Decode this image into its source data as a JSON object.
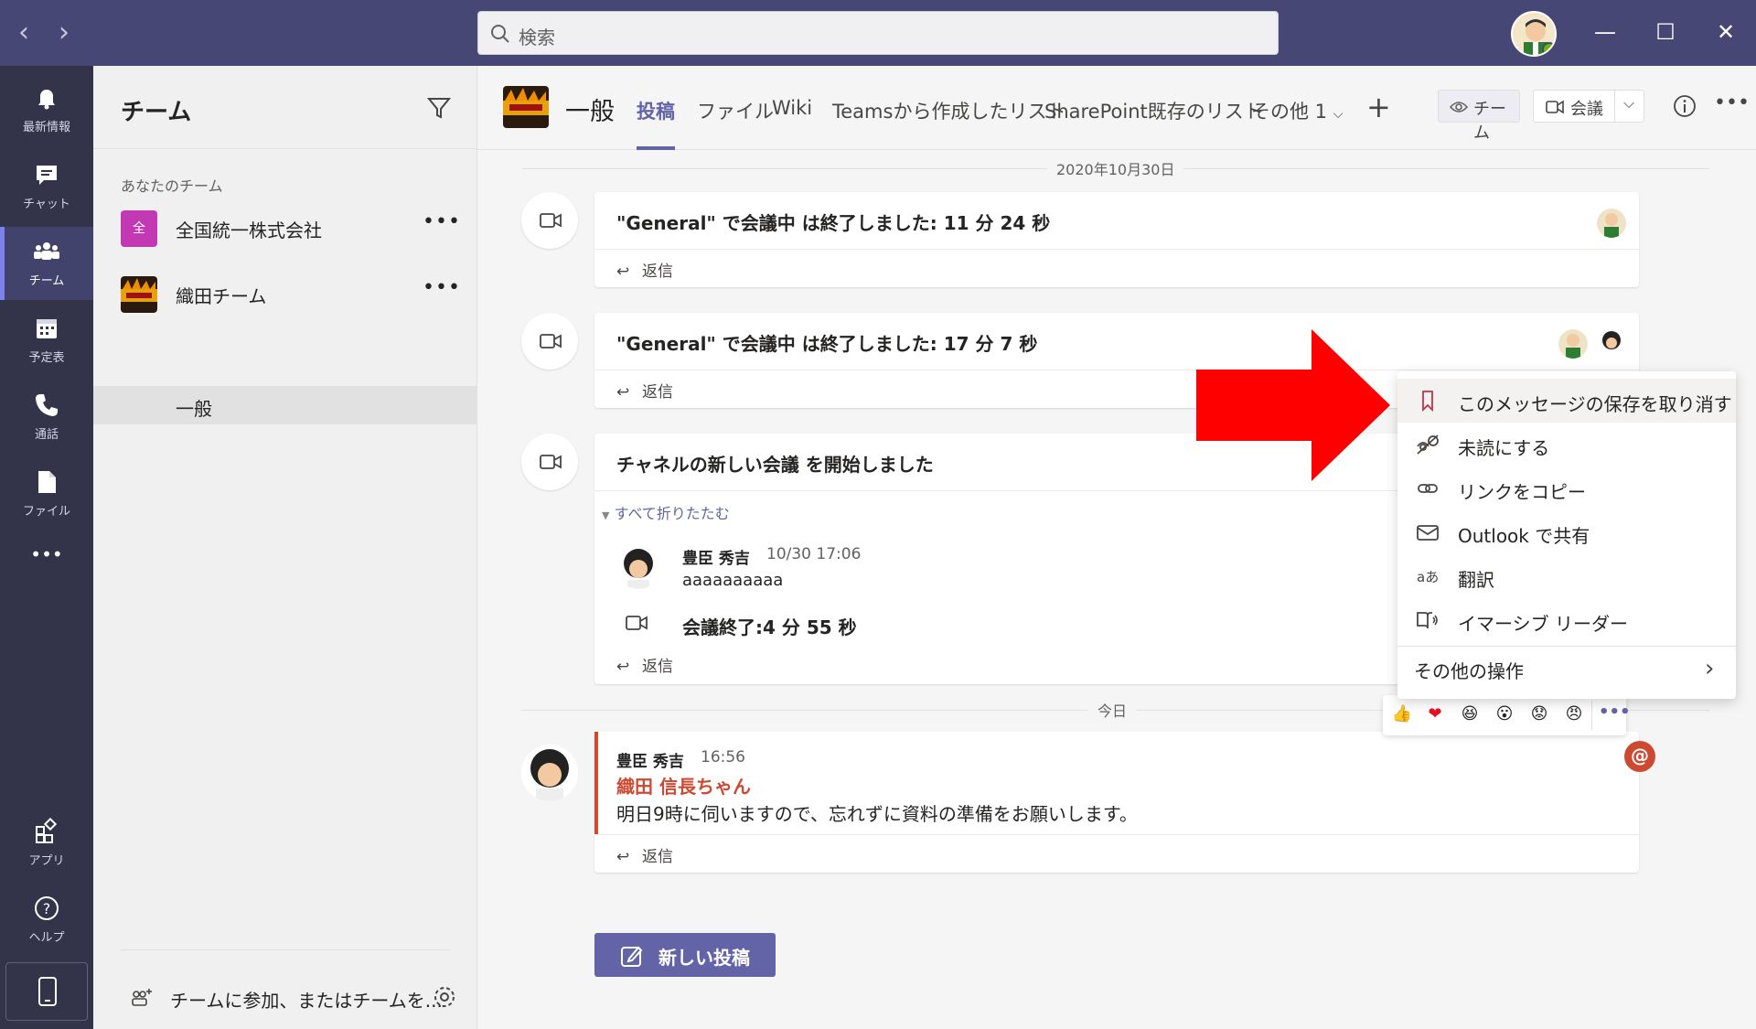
{
  "search": {
    "placeholder": "検索"
  },
  "appbar": {
    "items": [
      {
        "label": "最新情報",
        "icon": "bell-icon"
      },
      {
        "label": "チャット",
        "icon": "chat-icon"
      },
      {
        "label": "チーム",
        "icon": "teams-icon",
        "active": true
      },
      {
        "label": "予定表",
        "icon": "calendar-icon"
      },
      {
        "label": "通話",
        "icon": "phone-icon"
      },
      {
        "label": "ファイル",
        "icon": "file-icon"
      },
      {
        "label": "アプリ",
        "icon": "apps-icon"
      },
      {
        "label": "ヘルプ",
        "icon": "help-icon"
      }
    ],
    "more": "•••"
  },
  "teams_pane": {
    "title": "チーム",
    "section_label": "あなたのチーム",
    "teams": [
      {
        "name": "全国統一株式会社",
        "logo_text": "全",
        "logo_color": "#c239b3"
      },
      {
        "name": "織田チーム"
      }
    ],
    "more": "•••",
    "channel": "一般",
    "join_text": "チームに参加、またはチームを..."
  },
  "channel_header": {
    "title": "一般",
    "tabs": [
      "投稿",
      "ファイル",
      "Wiki",
      "Teamsから作成したリスト",
      "SharePoint既存のリスト",
      "その他 1"
    ],
    "add": "+",
    "team_button": "チーム",
    "meet_button": "会議"
  },
  "messages": {
    "date1": "2020年10月30日",
    "reply_label": "返信",
    "meeting1": "\"General\" で会議中 は終了しました: 11 分 24 秒",
    "meeting2": "\"General\" で会議中 は終了しました: 17 分 7 秒",
    "meeting3": "チャネルの新しい会議 を開始しました",
    "collapse_all": "すべて折りたたむ",
    "nested_author": "豊臣 秀吉",
    "nested_time": "10/30 17:06",
    "nested_text": "aaaaaaaaaa",
    "meeting_end": "会議終了:4 分 55 秒",
    "date2": "今日",
    "last_author": "豊臣 秀吉",
    "last_time": "16:56",
    "mention": "織田 信長ちゃん",
    "last_text": "明日9時に伺いますので、忘れずに資料の準備をお願いします。",
    "at_symbol": "@"
  },
  "context_menu": {
    "items": [
      {
        "label": "このメッセージの保存を取り消す",
        "icon": "bookmark-icon"
      },
      {
        "label": "未読にする",
        "icon": "unread-icon"
      },
      {
        "label": "リンクをコピー",
        "icon": "link-icon"
      },
      {
        "label": "Outlook で共有",
        "icon": "mail-icon"
      },
      {
        "label": "翻訳",
        "icon": "translate-icon"
      },
      {
        "label": "イマーシブ リーダー",
        "icon": "immersive-reader-icon"
      }
    ],
    "more_actions": "その他の操作"
  },
  "reactions": [
    "👍",
    "❤",
    "😆",
    "😮",
    "😟",
    "😠"
  ],
  "new_post_button": "新しい投稿",
  "colors": {
    "brand": "#6264a7",
    "titlebar": "#464775",
    "appbar": "#33344a",
    "arrow": "#ff0000",
    "mention": "#cc4a31"
  }
}
